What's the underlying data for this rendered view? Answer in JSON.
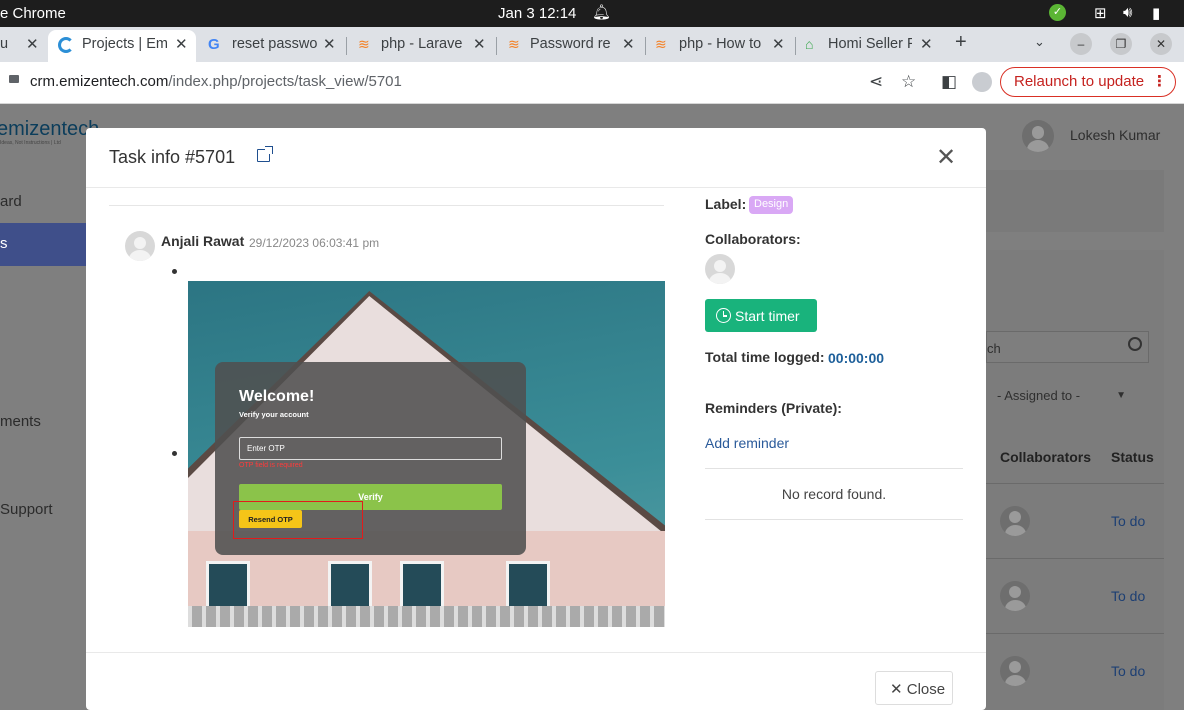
{
  "os": {
    "app_name": "e Chrome",
    "clock": "Jan 3  12:14"
  },
  "tabs": [
    {
      "title": "u"
    },
    {
      "title": "Projects | Em"
    },
    {
      "title": "reset passwo"
    },
    {
      "title": "php - Larave"
    },
    {
      "title": "Password re"
    },
    {
      "title": "php - How to"
    },
    {
      "title": "Homi Seller P"
    }
  ],
  "address": {
    "host": "crm.emizentech.com",
    "path": "/index.php/projects/task_view/5701",
    "relaunch": "Relaunch to update"
  },
  "app": {
    "logo": "emizentech",
    "logo_tag": "Ideas, Not Instructions | Ltd",
    "user_name": "Lokesh Kumar",
    "sidebar": [
      "ard",
      "s",
      "ments",
      "Support"
    ],
    "search_placeholder": "ch",
    "assigned_filter": "- Assigned to -",
    "columns": [
      "Collaborators",
      "Status"
    ],
    "rows": [
      {
        "status": "To do"
      },
      {
        "status": "To do"
      },
      {
        "status": "To do"
      }
    ]
  },
  "modal": {
    "title": "Task info #5701",
    "comment": {
      "author": "Anjali Rawat",
      "date": "29/12/2023 06:03:41 pm"
    },
    "screenshot": {
      "welcome": "Welcome!",
      "subtitle": "Verify your account",
      "otp_placeholder": "Enter OTP",
      "error": "OTP field is required",
      "verify": "Verify",
      "resend": "Resend OTP"
    },
    "label_title": "Label:",
    "label_value": "Design",
    "collaborators_title": "Collaborators:",
    "start_timer": "Start timer",
    "total_time_title": "Total time logged:",
    "total_time_value": "00:00:00",
    "reminders_title": "Reminders (Private):",
    "add_reminder": "Add reminder",
    "no_record": "No record found.",
    "close": "Close"
  },
  "colors": {
    "accent_green": "#19b37c",
    "design_badge": "#d9a8f5",
    "relaunch_red": "#d93025"
  }
}
